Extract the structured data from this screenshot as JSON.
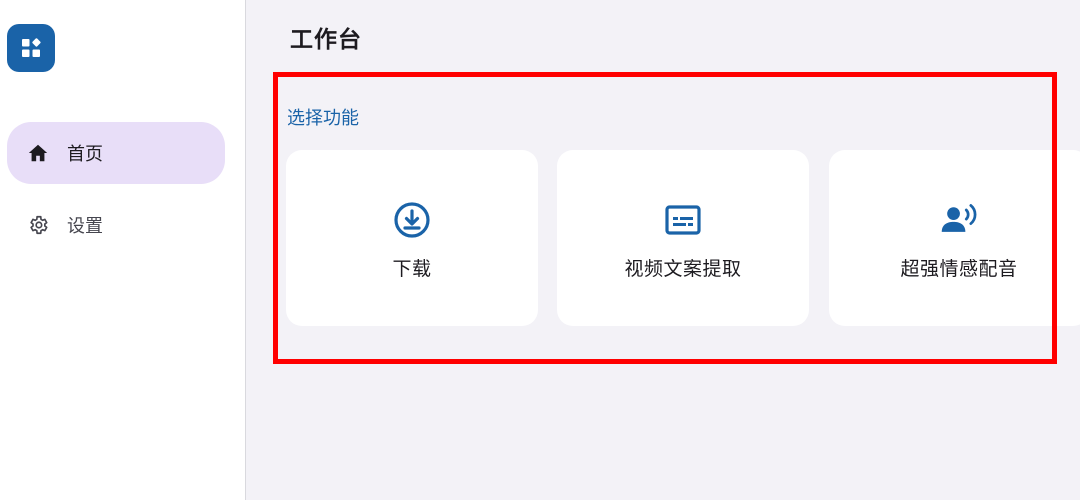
{
  "sidebar": {
    "logo_icon": "widgets-icon",
    "items": [
      {
        "label": "首页",
        "icon": "home-icon",
        "active": true
      },
      {
        "label": "设置",
        "icon": "gear-icon",
        "active": false
      }
    ]
  },
  "main": {
    "title": "工作台",
    "section_label": "选择功能",
    "cards": [
      {
        "label": "下载",
        "icon": "download-circle-icon"
      },
      {
        "label": "视频文案提取",
        "icon": "subtitles-icon"
      },
      {
        "label": "超强情感配音",
        "icon": "voice-icon"
      }
    ]
  },
  "colors": {
    "accent": "#1a63a8",
    "active_nav_bg": "#e8def8",
    "highlight": "#ff0000",
    "background": "#f3f2f7"
  }
}
